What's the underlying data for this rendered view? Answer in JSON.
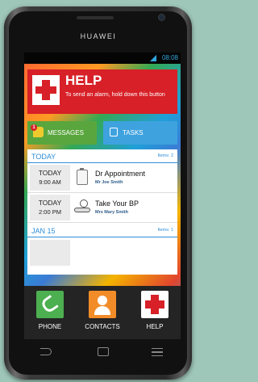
{
  "device": {
    "brand": "HUAWEI"
  },
  "status_bar": {
    "time": "08:08",
    "signal_icon": "signal-icon"
  },
  "help_banner": {
    "title": "HELP",
    "text": "To send an alarm, hold down this button",
    "icon": "red-cross-icon",
    "color": "#d72027"
  },
  "tiles": {
    "messages": {
      "label": "MESSAGES",
      "badge": "1",
      "icon": "message-icon",
      "color": "#5aa63e"
    },
    "tasks": {
      "label": "TASKS",
      "icon": "tasks-icon",
      "color": "#3ea2df"
    }
  },
  "agenda": {
    "sections": [
      {
        "title": "TODAY",
        "count": "Items: 2",
        "items": [
          {
            "day": "TODAY",
            "time": "9:00 AM",
            "title": "Dr Appointment",
            "who": "Mr Joe Smith",
            "icon": "clipboard-icon"
          },
          {
            "day": "TODAY",
            "time": "2:00 PM",
            "title": "Take Your BP",
            "who": "Mrs Mary Smith",
            "icon": "blood-pressure-icon"
          }
        ]
      },
      {
        "title": "JAN 15",
        "count": "Items: 1",
        "items": []
      }
    ]
  },
  "dock": [
    {
      "label": "PHONE",
      "icon": "phone-icon",
      "color": "#4caf50"
    },
    {
      "label": "CONTACTS",
      "icon": "contacts-icon",
      "color": "#f28c28"
    },
    {
      "label": "HELP",
      "icon": "red-cross-icon",
      "color": "#ffffff"
    }
  ],
  "nav": {
    "back": "back-icon",
    "home": "home-icon",
    "menu": "menu-icon"
  },
  "accent_color": "#2f8ed8"
}
